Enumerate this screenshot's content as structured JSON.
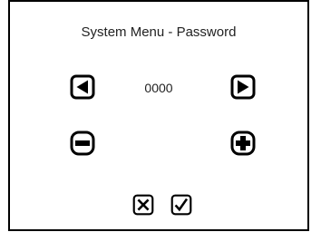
{
  "window": {
    "title": "System Menu - Password"
  },
  "password": {
    "value": "0000"
  },
  "controls": {
    "prev_icon": "left-arrow-icon",
    "next_icon": "right-arrow-icon",
    "decrement_icon": "minus-icon",
    "increment_icon": "plus-icon",
    "cancel_icon": "x-icon",
    "confirm_icon": "check-icon"
  },
  "colors": {
    "foreground": "#000000",
    "text": "#222222",
    "background": "#ffffff"
  }
}
